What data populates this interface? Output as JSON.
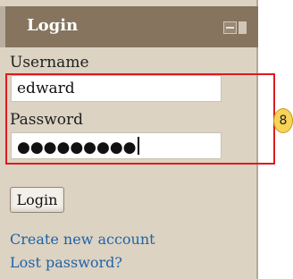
{
  "block": {
    "title": "Login"
  },
  "form": {
    "username_label": "Username",
    "username_value": "edward",
    "password_label": "Password",
    "password_mask": "●●●●●●●●●",
    "submit_label": "Login"
  },
  "links": {
    "create_account": "Create new account",
    "lost_password": "Lost password?"
  },
  "annotation": {
    "badge_number": "8"
  },
  "colors": {
    "panel_bg": "#dcd3c3",
    "titlebar_bg": "#86745f",
    "link": "#1f63a8",
    "highlight": "#e0191f",
    "badge": "#f7d35a"
  }
}
